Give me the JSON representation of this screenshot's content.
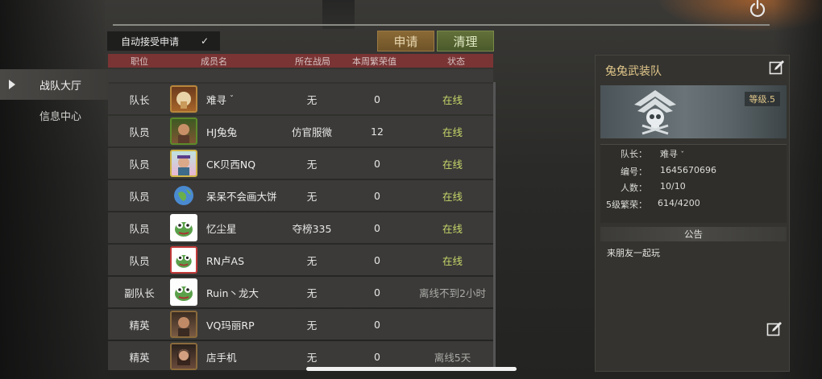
{
  "nav": {
    "items": [
      {
        "label": "战队大厅",
        "active": true
      },
      {
        "label": "信息中心",
        "active": false
      }
    ]
  },
  "controls": {
    "auto_accept_label": "自动接受申请",
    "auto_accept_checked": "✓",
    "apply_label": "申请",
    "clear_label": "清理"
  },
  "table": {
    "headers": {
      "role": "职位",
      "name": "成员名",
      "zone": "所在战局",
      "prosperity": "本周繁荣值",
      "status": "状态"
    },
    "rows": [
      {
        "role": "队长",
        "name": "难寻",
        "name_suffix": "ˇ",
        "zone": "无",
        "prosperity": "0",
        "status": "在线",
        "online": true,
        "avatar": "gold-frame-avatar"
      },
      {
        "role": "队员",
        "name": "HJ兔兔",
        "name_suffix": "",
        "zone": "仿官服微",
        "prosperity": "12",
        "status": "在线",
        "online": true,
        "avatar": "green-frame-avatar"
      },
      {
        "role": "队员",
        "name": "CK贝西NQ",
        "name_suffix": "",
        "zone": "无",
        "prosperity": "0",
        "status": "在线",
        "online": true,
        "avatar": "pink-frame-avatar"
      },
      {
        "role": "队员",
        "name": "呆呆不会画大饼",
        "name_suffix": "",
        "zone": "无",
        "prosperity": "0",
        "status": "在线",
        "online": true,
        "avatar": "globe-avatar"
      },
      {
        "role": "队员",
        "name": "忆尘星",
        "name_suffix": "",
        "zone": "夺榜335",
        "prosperity": "0",
        "status": "在线",
        "online": true,
        "avatar": "pepe-avatar"
      },
      {
        "role": "队员",
        "name": "RN卢AS",
        "name_suffix": "",
        "zone": "无",
        "prosperity": "0",
        "status": "在线",
        "online": true,
        "avatar": "pepe-red-frame-avatar"
      },
      {
        "role": "副队长",
        "name": "Ruin丶龙大",
        "name_suffix": "",
        "zone": "无",
        "prosperity": "0",
        "status": "离线不到2小时",
        "online": false,
        "avatar": "pepe-avatar"
      },
      {
        "role": "精英",
        "name": "VQ玛丽RP",
        "name_suffix": "",
        "zone": "无",
        "prosperity": "0",
        "status": "",
        "online": false,
        "avatar": "man-avatar"
      },
      {
        "role": "精英",
        "name": "店手机",
        "name_suffix": "",
        "zone": "无",
        "prosperity": "0",
        "status": "离线5天",
        "online": false,
        "avatar": "woman-avatar"
      }
    ]
  },
  "team": {
    "name": "兔兔武装队",
    "level": "等级.5",
    "captain_label": "队长：",
    "captain_value": "难寻",
    "captain_suffix": "ˇ",
    "id_label": "编号：",
    "id_value": "1645670696",
    "members_label": "人数：",
    "members_value": "10/10",
    "prosperity_label": "5级繁荣：",
    "prosperity_value": "614/4200",
    "notice_title": "公告",
    "notice_text": "来朋友一起玩"
  },
  "colors": {
    "header_red": "#7a3434",
    "online_green": "#c8d86a",
    "gold_text": "#e4c98c",
    "apply_button": "#7d6030",
    "clear_button": "#566434"
  },
  "icons": {
    "power": "power-icon",
    "edit": "edit-icon",
    "checkbox": "checkmark-icon",
    "nav_arrow": "triangle-right-icon"
  }
}
